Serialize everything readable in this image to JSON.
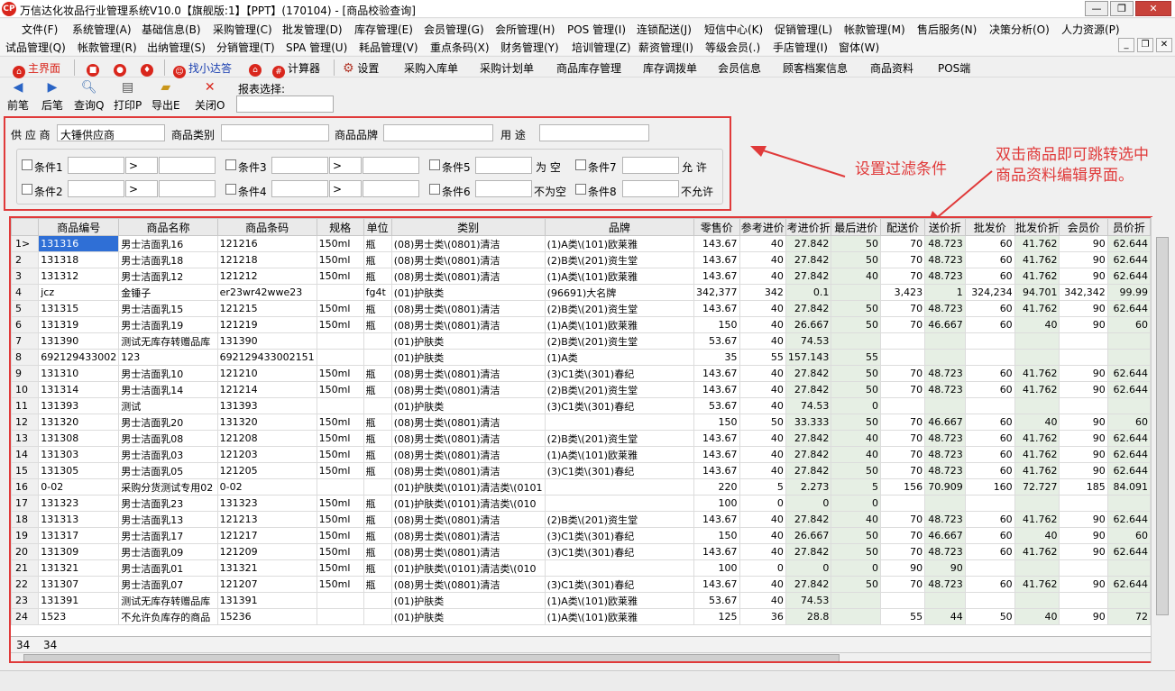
{
  "window": {
    "title": "万信达化妆品行业管理系统V10.0【旗舰版:1】【PPT】(170104) - [商品校验查询]",
    "logo_text": "CP",
    "minimize": "—",
    "restore": "❐",
    "close": "✕"
  },
  "menu1": [
    "文件(F)",
    "系统管理(A)",
    "基础信息(B)",
    "采购管理(C)",
    "批发管理(D)",
    "库存管理(E)",
    "会员管理(G)",
    "会所管理(H)",
    "POS 管理(I)",
    "连锁配送(J)",
    "短信中心(K)",
    "促销管理(L)",
    "帐款管理(M)",
    "售后服务(N)",
    "决策分析(O)",
    "人力资源(P)"
  ],
  "menu2": [
    "试品管理(Q)",
    "帐款管理(R)",
    "出纳管理(S)",
    "分销管理(T)",
    "SPA 管理(U)",
    "耗品管理(V)",
    "重点条码(X)",
    "财务管理(Y)",
    "培训管理(Z)",
    "薪资管理(I)",
    "等级会员(.)",
    "手店管理(I)",
    "窗体(W)"
  ],
  "quick": {
    "home": "主界面",
    "find": "找小达答",
    "calc": "计算器",
    "settings": "设置",
    "items": [
      "采购入库单",
      "采购计划单",
      "商品库存管理",
      "库存调拨单",
      "会员信息",
      "顾客档案信息",
      "商品资料",
      "POS端"
    ]
  },
  "toolbar": {
    "prev": "前笔",
    "next": "后笔",
    "query": "查询Q",
    "print": "打印P",
    "export": "导出E",
    "close": "关闭O",
    "report_label": "报表选择:"
  },
  "filters": {
    "supplier_label": "供 应 商",
    "supplier_value": "大锤供应商",
    "category_label": "商品类别",
    "brand_label": "商品品牌",
    "usage_label": "用  途",
    "conds": [
      "条件1",
      "条件2",
      "条件3",
      "条件4",
      "条件5",
      "条件6",
      "条件7",
      "条件8"
    ],
    "gt": ">",
    "empty": "为  空",
    "notempty": "不为空",
    "allow": "允  许",
    "disallow": "不允许"
  },
  "annotations": {
    "filter": "设置过滤条件",
    "grid_line1": "双击商品即可跳转选中",
    "grid_line2": "商品资料编辑界面。"
  },
  "grid": {
    "columns": [
      "",
      "商品编号",
      "商品名称",
      "商品条码",
      "规格",
      "单位",
      "类别",
      "品牌",
      "零售价",
      "参考进价",
      "考进价折",
      "最后进价",
      "配送价",
      "送价折",
      "批发价",
      "批发价折",
      "会员价",
      "员价折"
    ],
    "rows": [
      [
        "1>",
        "131316",
        "男士洁面乳16",
        "121216",
        "150ml",
        "瓶",
        "(08)男士类\\(0801)清洁",
        "(1)A类\\(101)欧莱雅",
        "143.67",
        "40",
        "27.842",
        "50",
        "70",
        "48.723",
        "60",
        "41.762",
        "90",
        "62.644"
      ],
      [
        "2",
        "131318",
        "男士洁面乳18",
        "121218",
        "150ml",
        "瓶",
        "(08)男士类\\(0801)清洁",
        "(2)B类\\(201)资生堂",
        "143.67",
        "40",
        "27.842",
        "50",
        "70",
        "48.723",
        "60",
        "41.762",
        "90",
        "62.644"
      ],
      [
        "3",
        "131312",
        "男士洁面乳12",
        "121212",
        "150ml",
        "瓶",
        "(08)男士类\\(0801)清洁",
        "(1)A类\\(101)欧莱雅",
        "143.67",
        "40",
        "27.842",
        "40",
        "70",
        "48.723",
        "60",
        "41.762",
        "90",
        "62.644"
      ],
      [
        "4",
        "jcz",
        "金锤子",
        "er23wr42wwe23",
        "",
        "fg4t",
        "(01)护肤类",
        "(96691)大名牌",
        "342,377",
        "342",
        "0.1",
        "",
        "3,423",
        "1",
        "324,234",
        "94.701",
        "342,342",
        "99.99"
      ],
      [
        "5",
        "131315",
        "男士洁面乳15",
        "121215",
        "150ml",
        "瓶",
        "(08)男士类\\(0801)清洁",
        "(2)B类\\(201)资生堂",
        "143.67",
        "40",
        "27.842",
        "50",
        "70",
        "48.723",
        "60",
        "41.762",
        "90",
        "62.644"
      ],
      [
        "6",
        "131319",
        "男士洁面乳19",
        "121219",
        "150ml",
        "瓶",
        "(08)男士类\\(0801)清洁",
        "(1)A类\\(101)欧莱雅",
        "150",
        "40",
        "26.667",
        "50",
        "70",
        "46.667",
        "60",
        "40",
        "90",
        "60"
      ],
      [
        "7",
        "131390",
        "测试无库存转赠品库",
        "131390",
        "",
        "",
        "(01)护肤类",
        "(2)B类\\(201)资生堂",
        "53.67",
        "40",
        "74.53",
        "",
        "",
        "",
        "",
        "",
        "",
        ""
      ],
      [
        "8",
        "692129433002",
        "123",
        "692129433002151",
        "",
        "",
        "(01)护肤类",
        "(1)A类",
        "35",
        "55",
        "157.143",
        "55",
        "",
        "",
        "",
        "",
        "",
        ""
      ],
      [
        "9",
        "131310",
        "男士洁面乳10",
        "121210",
        "150ml",
        "瓶",
        "(08)男士类\\(0801)清洁",
        "(3)C1类\\(301)春纪",
        "143.67",
        "40",
        "27.842",
        "50",
        "70",
        "48.723",
        "60",
        "41.762",
        "90",
        "62.644"
      ],
      [
        "10",
        "131314",
        "男士洁面乳14",
        "121214",
        "150ml",
        "瓶",
        "(08)男士类\\(0801)清洁",
        "(2)B类\\(201)资生堂",
        "143.67",
        "40",
        "27.842",
        "50",
        "70",
        "48.723",
        "60",
        "41.762",
        "90",
        "62.644"
      ],
      [
        "11",
        "131393",
        "测试",
        "131393",
        "",
        "",
        "(01)护肤类",
        "(3)C1类\\(301)春纪",
        "53.67",
        "40",
        "74.53",
        "0",
        "",
        "",
        "",
        "",
        "",
        ""
      ],
      [
        "12",
        "131320",
        "男士洁面乳20",
        "131320",
        "150ml",
        "瓶",
        "(08)男士类\\(0801)清洁",
        "",
        "150",
        "50",
        "33.333",
        "50",
        "70",
        "46.667",
        "60",
        "40",
        "90",
        "60"
      ],
      [
        "13",
        "131308",
        "男士洁面乳08",
        "121208",
        "150ml",
        "瓶",
        "(08)男士类\\(0801)清洁",
        "(2)B类\\(201)资生堂",
        "143.67",
        "40",
        "27.842",
        "40",
        "70",
        "48.723",
        "60",
        "41.762",
        "90",
        "62.644"
      ],
      [
        "14",
        "131303",
        "男士洁面乳03",
        "121203",
        "150ml",
        "瓶",
        "(08)男士类\\(0801)清洁",
        "(1)A类\\(101)欧莱雅",
        "143.67",
        "40",
        "27.842",
        "40",
        "70",
        "48.723",
        "60",
        "41.762",
        "90",
        "62.644"
      ],
      [
        "15",
        "131305",
        "男士洁面乳05",
        "121205",
        "150ml",
        "瓶",
        "(08)男士类\\(0801)清洁",
        "(3)C1类\\(301)春纪",
        "143.67",
        "40",
        "27.842",
        "50",
        "70",
        "48.723",
        "60",
        "41.762",
        "90",
        "62.644"
      ],
      [
        "16",
        "0-02",
        "采购分货测试专用02",
        "0-02",
        "",
        "",
        "(01)护肤类\\(0101)清洁类\\(0101",
        "",
        "220",
        "5",
        "2.273",
        "5",
        "156",
        "70.909",
        "160",
        "72.727",
        "185",
        "84.091"
      ],
      [
        "17",
        "131323",
        "男士洁面乳23",
        "131323",
        "150ml",
        "瓶",
        "(01)护肤类\\(0101)清洁类\\(010",
        "",
        "100",
        "0",
        "0",
        "0",
        "",
        "",
        "",
        "",
        "",
        ""
      ],
      [
        "18",
        "131313",
        "男士洁面乳13",
        "121213",
        "150ml",
        "瓶",
        "(08)男士类\\(0801)清洁",
        "(2)B类\\(201)资生堂",
        "143.67",
        "40",
        "27.842",
        "40",
        "70",
        "48.723",
        "60",
        "41.762",
        "90",
        "62.644"
      ],
      [
        "19",
        "131317",
        "男士洁面乳17",
        "121217",
        "150ml",
        "瓶",
        "(08)男士类\\(0801)清洁",
        "(3)C1类\\(301)春纪",
        "150",
        "40",
        "26.667",
        "50",
        "70",
        "46.667",
        "60",
        "40",
        "90",
        "60"
      ],
      [
        "20",
        "131309",
        "男士洁面乳09",
        "121209",
        "150ml",
        "瓶",
        "(08)男士类\\(0801)清洁",
        "(3)C1类\\(301)春纪",
        "143.67",
        "40",
        "27.842",
        "50",
        "70",
        "48.723",
        "60",
        "41.762",
        "90",
        "62.644"
      ],
      [
        "21",
        "131321",
        "男士洁面乳01",
        "131321",
        "150ml",
        "瓶",
        "(01)护肤类\\(0101)清洁类\\(010",
        "",
        "100",
        "0",
        "0",
        "0",
        "90",
        "90",
        "",
        "",
        "",
        ""
      ],
      [
        "22",
        "131307",
        "男士洁面乳07",
        "121207",
        "150ml",
        "瓶",
        "(08)男士类\\(0801)清洁",
        "(3)C1类\\(301)春纪",
        "143.67",
        "40",
        "27.842",
        "50",
        "70",
        "48.723",
        "60",
        "41.762",
        "90",
        "62.644"
      ],
      [
        "23",
        "131391",
        "测试无库存转赠品库",
        "131391",
        "",
        "",
        "(01)护肤类",
        "(1)A类\\(101)欧莱雅",
        "53.67",
        "40",
        "74.53",
        "",
        "",
        "",
        "",
        "",
        "",
        ""
      ],
      [
        "24",
        "1523",
        "不允许负库存的商品",
        "15236",
        "",
        "",
        "(01)护肤类",
        "(1)A类\\(101)欧莱雅",
        "125",
        "36",
        "28.8",
        "",
        "55",
        "44",
        "50",
        "40",
        "90",
        "72"
      ]
    ],
    "footer_count": "34",
    "footer_total": "34"
  }
}
